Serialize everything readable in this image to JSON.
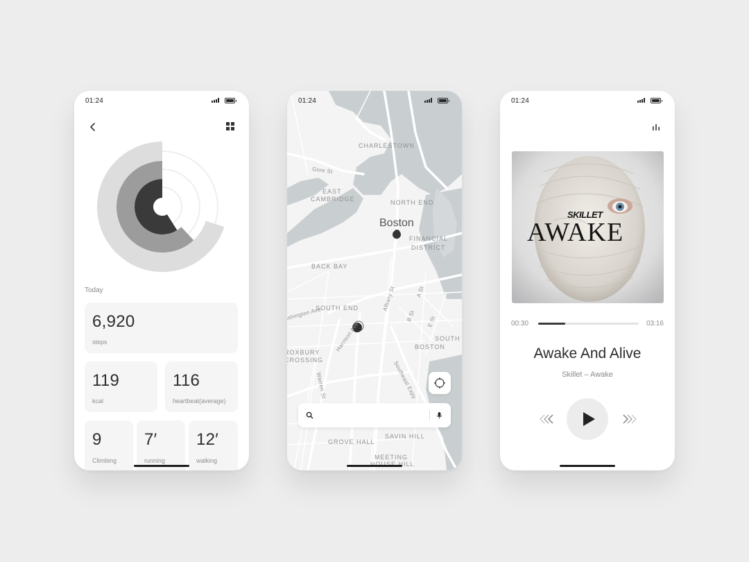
{
  "status_time": "01:24",
  "fitness": {
    "today_label": "Today",
    "rings": [
      0.7,
      0.62,
      0.59
    ],
    "steps": {
      "value": "6,920",
      "label": "steps"
    },
    "kcal": {
      "value": "119",
      "label": "kcal"
    },
    "heartbeat": {
      "value": "116",
      "label": "heartbeat(average)"
    },
    "climbing": {
      "value": "9",
      "label": "Climbing"
    },
    "running": {
      "value": "7′",
      "label": "running"
    },
    "walking": {
      "value": "12′",
      "label": "walking"
    },
    "colors": {
      "outer": "#dddddd",
      "middle": "#9c9c9c",
      "inner": "#3a3a3a"
    }
  },
  "map": {
    "city": "Boston",
    "neighborhoods": [
      "CHARLESTOWN",
      "NORTH END",
      "FINANCIAL",
      "DISTRICT",
      "BACK BAY",
      "SOUTH END",
      "SOUTH",
      "BOSTON",
      "EAST",
      "CAMBRIDGE",
      "GROVE HALL",
      "SAVIN HILL",
      "MEETING",
      "HOUSE HILL",
      "ROXBURY",
      "CROSSING"
    ],
    "streets": [
      "Gore St",
      "Albany St",
      "A St",
      "B St",
      "E St",
      "Harrison Ave",
      "Warren St",
      "Southeast Expy",
      "Washington Ave"
    ],
    "search": {
      "placeholder": "",
      "value": ""
    }
  },
  "music": {
    "album_band": "SKILLET",
    "album_name": "AWAKE",
    "current_time": "00:30",
    "total_time": "03:16",
    "progress": 0.27,
    "title": "Awake And Alive",
    "subtitle": "Skillet – Awake"
  }
}
